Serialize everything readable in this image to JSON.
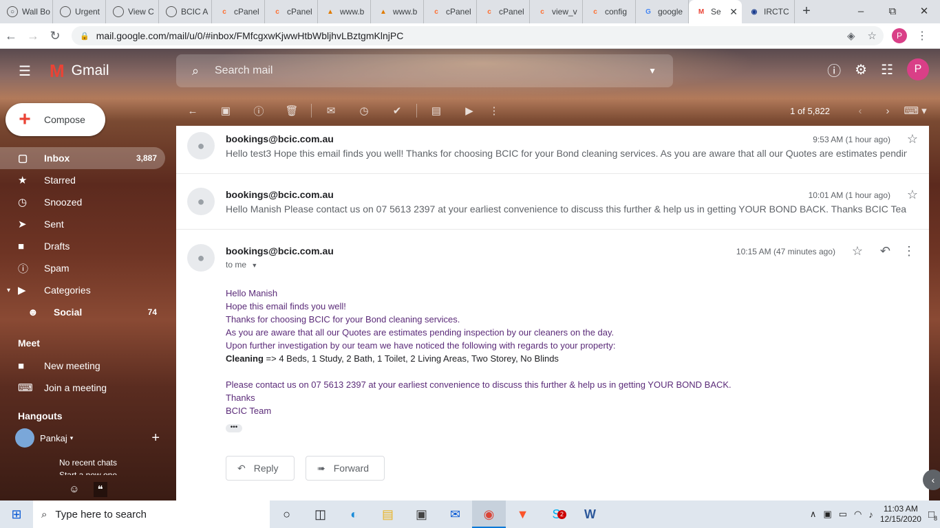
{
  "browser": {
    "tabs": [
      {
        "label": "Wall Bo",
        "icon": "globe-icon"
      },
      {
        "label": "Urgent",
        "icon": "globe-icon"
      },
      {
        "label": "View C",
        "icon": "globe-icon"
      },
      {
        "label": "BCIC A",
        "icon": "globe-icon"
      },
      {
        "label": "cPanel",
        "icon": "cpanel-icon"
      },
      {
        "label": "cPanel",
        "icon": "cpanel-icon"
      },
      {
        "label": "www.b",
        "icon": "phpmyadmin-icon"
      },
      {
        "label": "www.b",
        "icon": "phpmyadmin-icon"
      },
      {
        "label": "cPanel",
        "icon": "cpanel-icon"
      },
      {
        "label": "cPanel",
        "icon": "cpanel-icon"
      },
      {
        "label": "view_v",
        "icon": "cpanel-icon"
      },
      {
        "label": "config",
        "icon": "cpanel-icon"
      },
      {
        "label": "google",
        "icon": "google-icon"
      },
      {
        "label": "Se",
        "icon": "gmail-icon",
        "active": true
      },
      {
        "label": "IRCTC",
        "icon": "irctc-icon"
      }
    ],
    "url": "mail.google.com/mail/u/0/#inbox/FMfcgxwKjwwHtbWbljhvLBztgmKlnjPC",
    "profile_initial": "P"
  },
  "gmail": {
    "brand": "Gmail",
    "search_placeholder": "Search mail",
    "profile_initial": "P",
    "pager": "1 of 5,822",
    "compose_label": "Compose",
    "nav": {
      "inbox": {
        "label": "Inbox",
        "count": "3,887"
      },
      "starred": {
        "label": "Starred"
      },
      "snoozed": {
        "label": "Snoozed"
      },
      "sent": {
        "label": "Sent"
      },
      "drafts": {
        "label": "Drafts"
      },
      "spam": {
        "label": "Spam"
      },
      "categories": {
        "label": "Categories"
      },
      "social": {
        "label": "Social",
        "count": "74"
      }
    },
    "meet": {
      "title": "Meet",
      "new_meeting": "New meeting",
      "join_meeting": "Join a meeting"
    },
    "hangouts": {
      "title": "Hangouts",
      "user": "Pankaj",
      "no_recent": "No recent chats",
      "start_new": "Start a new one"
    }
  },
  "thread": [
    {
      "from": "bookings@bcic.com.au",
      "time": "9:53 AM (1 hour ago)",
      "snippet": "Hello test3 Hope this email finds you well! Thanks for choosing BCIC for your Bond cleaning services. As you are aware that all our Quotes are estimates pending"
    },
    {
      "from": "bookings@bcic.com.au",
      "time": "10:01 AM (1 hour ago)",
      "snippet": "Hello Manish Please contact us on 07 5613 2397 at your earliest convenience to discuss this further & help us in getting YOUR BOND BACK. Thanks BCIC Team"
    }
  ],
  "open_message": {
    "from": "bookings@bcic.com.au",
    "to": "to me",
    "time": "10:15 AM (47 minutes ago)",
    "lines": [
      "Hello Manish",
      "Hope this email finds you well!",
      "Thanks for choosing BCIC for your Bond cleaning services.",
      "As you are aware that all our Quotes are estimates pending inspection by our cleaners on the day.",
      "Upon further investigation by our team we have noticed the following with regards to your property:"
    ],
    "cleaning_label": "Cleaning",
    "cleaning_value": "=> 4 Beds, 1 Study, 2 Bath, 1 Toilet, 2 Living Areas, Two Storey, No Blinds",
    "closing": [
      "Please contact us on 07 5613 2397 at your earliest convenience to discuss this further & help us in getting YOUR BOND BACK.",
      "Thanks",
      "BCIC Team"
    ],
    "reply_label": "Reply",
    "forward_label": "Forward"
  },
  "taskbar": {
    "search_placeholder": "Type here to search",
    "time": "11:03 AM",
    "date": "12/15/2020",
    "notifications": "8",
    "skype_badge": "2"
  },
  "colors": {
    "body_text": "#5a2a78",
    "profile": "#d93f87",
    "active_tab_indicator": "#0078d7"
  }
}
